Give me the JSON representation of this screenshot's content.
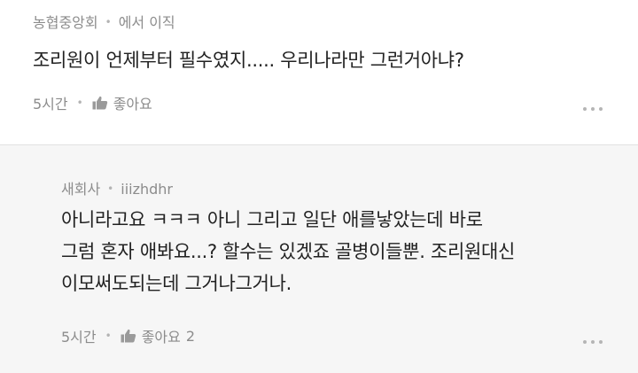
{
  "comments": [
    {
      "author": "농협중앙회",
      "affiliation": "에서 이직",
      "text": "조리원이 언제부터 필수였지..... 우리나라만 그런거아냐?",
      "time": "5시간",
      "like_label": "좋아요",
      "like_count": "",
      "icons": {
        "like": "thumbs-up-icon",
        "more": "more-options-icon"
      }
    },
    {
      "author": "새회사",
      "handle": "iiizhdhr",
      "text_lines": [
        "아니라고요 ㅋㅋㅋ 아니 그리고 일단 애를낳았는데 바로",
        "그럼 혼자 애봐요...? 할수는 있겠죠 골병이들뿐. 조리원대신",
        "이모써도되는데 그거나그거나."
      ],
      "time": "5시간",
      "like_label": "좋아요",
      "like_count": "2",
      "icons": {
        "like": "thumbs-up-icon",
        "more": "more-options-icon"
      }
    }
  ],
  "colors": {
    "reply_background": "#f6f6f6",
    "meta_text": "#8c8c8c",
    "body_text": "#222222"
  }
}
